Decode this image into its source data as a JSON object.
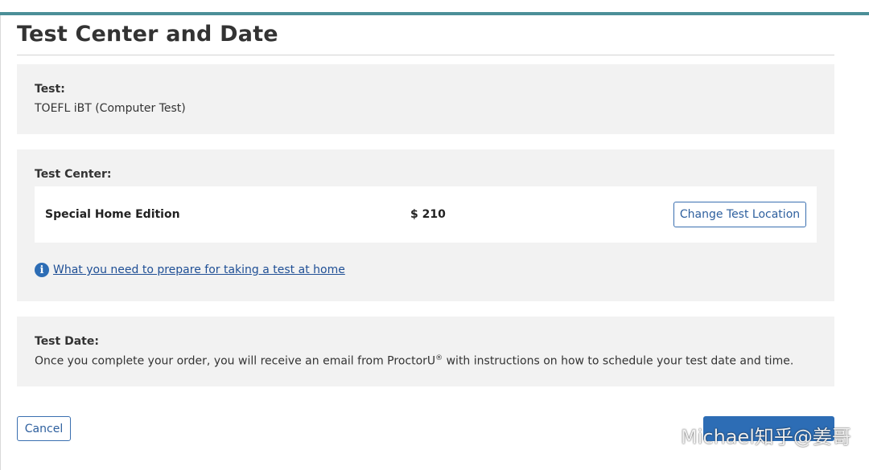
{
  "page": {
    "title": "Test Center and Date"
  },
  "test_section": {
    "label": "Test:",
    "value": "TOEFL iBT (Computer Test)"
  },
  "test_center_section": {
    "label": "Test Center:",
    "center_name": "Special Home Edition",
    "price": "$ 210",
    "change_button_label": "Change Test Location",
    "info_link_text": "What you need to prepare for taking a test at home"
  },
  "test_date_section": {
    "label": "Test Date:",
    "text_before": "Once you complete your order, you will receive an email from ProctorU",
    "registered_mark": "®",
    "text_after": " with instructions on how to schedule your test date and time."
  },
  "footer": {
    "cancel_label": "Cancel",
    "continue_label": ""
  },
  "watermark": {
    "text": "Michael知乎@姜哥",
    "icon": "wechat-icon"
  },
  "colors": {
    "accent": "#4b8f98",
    "primary_button": "#2d6db5",
    "link": "#1f4f95",
    "panel_bg": "#f2f2f2"
  }
}
